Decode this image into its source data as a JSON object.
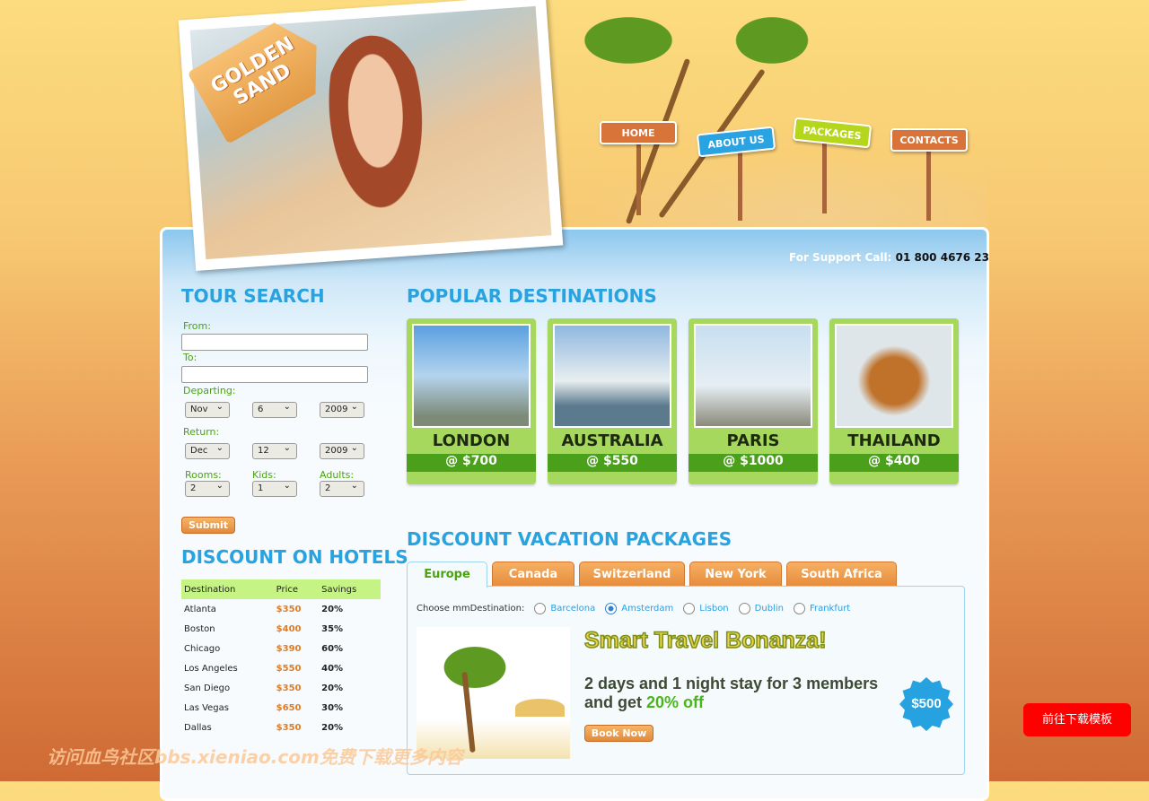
{
  "brand": {
    "logo_text": "GOLDEN SAND"
  },
  "nav": [
    {
      "label": "HOME",
      "color": "#d8743a"
    },
    {
      "label": "ABOUT US",
      "color": "#2aa3e2"
    },
    {
      "label": "PACKAGES",
      "color": "#b6d61e"
    },
    {
      "label": "CONTACTS",
      "color": "#d8743a"
    }
  ],
  "support": {
    "label": "For Support Call:",
    "phone": "01 800 4676 23"
  },
  "tour_search": {
    "title": "TOUR SEARCH",
    "from_label": "From:",
    "from_value": "",
    "to_label": "To:",
    "to_value": "",
    "departing_label": "Departing:",
    "departing": {
      "month": "Nov",
      "day": "6",
      "year": "2009"
    },
    "return_label": "Return:",
    "return": {
      "month": "Dec",
      "day": "12",
      "year": "2009"
    },
    "rooms_label": "Rooms:",
    "rooms": "2",
    "kids_label": "Kids:",
    "kids": "1",
    "adults_label": "Adults:",
    "adults": "2",
    "submit": "Submit"
  },
  "hotels": {
    "title": "DISCOUNT ON HOTELS",
    "columns": [
      "Destination",
      "Price",
      "Savings"
    ],
    "rows": [
      [
        "Atlanta",
        "$350",
        "20%"
      ],
      [
        "Boston",
        "$400",
        "35%"
      ],
      [
        "Chicago",
        "$390",
        "60%"
      ],
      [
        "Los Angeles",
        "$550",
        "40%"
      ],
      [
        "San Diego",
        "$350",
        "20%"
      ],
      [
        "Las Vegas",
        "$650",
        "30%"
      ],
      [
        "Dallas",
        "$350",
        "20%"
      ]
    ]
  },
  "destinations": {
    "title": "POPULAR DESTINATIONS",
    "items": [
      {
        "name": "LONDON",
        "price": "@ $700"
      },
      {
        "name": "AUSTRALIA",
        "price": "@ $550"
      },
      {
        "name": "PARIS",
        "price": "@ $1000"
      },
      {
        "name": "THAILAND",
        "price": "@ $400"
      }
    ]
  },
  "packages": {
    "title": "DISCOUNT VACATION PACKAGES",
    "tabs": [
      "Europe",
      "Canada",
      "Switzerland",
      "New York",
      "South Africa"
    ],
    "active_tab": "Europe",
    "choose_label": "Choose mmDestination:",
    "options": [
      "Barcelona",
      "Amsterdam",
      "Lisbon",
      "Dublin",
      "Frankfurt"
    ],
    "selected": "Amsterdam",
    "headline": "Smart Travel Bonanza!",
    "desc": "2 days and 1 night stay for 3 members",
    "desc2": "and get ",
    "discount": "20% off",
    "price": "$500",
    "book": "Book Now"
  },
  "watermark": "访问血鸟社区bbs.xieniao.com免费下载更多内容",
  "download_button": "前往下载模板"
}
